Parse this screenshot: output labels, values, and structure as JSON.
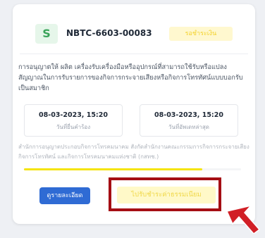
{
  "card": {
    "avatar_letter": "S",
    "document_id": "NBTC-6603-00083",
    "status": "รอชำระเงิน",
    "description": "การอนุญาตให้ ผลิต เครื่องรับเครื่องมือหรืออุปกรณ์ที่สามารถใช้รับหรือแปลงสัญญาณในการรับรายการของกิจการกระจายเสียงหรือกิจการโทรทัศน์แบบบอกรับเป็นสมาชิก",
    "dates": [
      {
        "value": "08-03-2023, 15:20",
        "label": "วันที่ยื่นคำร้อง"
      },
      {
        "value": "08-03-2023, 15:20",
        "label": "วันที่อัพเดทล่าสุด"
      }
    ],
    "agency": "สำนักการอนุญาตประกอบกิจการโทรคมนาคม สังกัดสำนักงานคณะกรรมการกิจการกระจายเสียง กิจการโทรทัศน์ และกิจการโทรคมนาคมแห่งชาติ (กสทช.)",
    "progress_fraction": 0.82,
    "details_label": "ดูรายละเอียด",
    "pay_label": "ไปรับชำระค่าธรรมเนียม"
  },
  "colors": {
    "accent_blue": "#2f6bd4",
    "highlight_red": "#a50e14",
    "progress_yellow": "#f5e40d",
    "status_yellow": "#f3d12a"
  },
  "icons": {
    "cursor": "cursor-arrow-icon"
  }
}
